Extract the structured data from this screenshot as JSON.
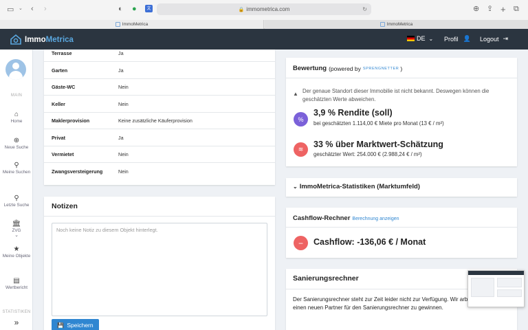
{
  "browser": {
    "url": "immometrica.com",
    "tabs": [
      "ImmoMetrica",
      "ImmoMetrica"
    ]
  },
  "header": {
    "logo_part1": "Immo",
    "logo_part2": "Metrica",
    "language": "DE",
    "profile": "Profil",
    "logout": "Logout"
  },
  "sidebar": {
    "section_main": "MAIN",
    "items": [
      {
        "label": "Home",
        "icon": "home-icon"
      },
      {
        "label": "Neue Suche",
        "icon": "search-plus-icon"
      },
      {
        "label": "Meine Suchen",
        "icon": "search-icon"
      },
      {
        "label": "Letzte Suche",
        "icon": "search-icon"
      },
      {
        "label": "ZVG",
        "icon": "bank-icon"
      },
      {
        "label": "Meine Objekte",
        "icon": "star-icon"
      },
      {
        "label": "Wertbericht",
        "icon": "report-icon"
      }
    ],
    "section_stats": "STATISTIKEN",
    "expand": "»"
  },
  "details": [
    {
      "key": "Terrasse",
      "value": "Ja"
    },
    {
      "key": "Garten",
      "value": "Ja"
    },
    {
      "key": "Gäste-WC",
      "value": "Nein"
    },
    {
      "key": "Keller",
      "value": "Nein"
    },
    {
      "key": "Maklerprovision",
      "value": "Keine zusätzliche Käuferprovision"
    },
    {
      "key": "Privat",
      "value": "Ja"
    },
    {
      "key": "Vermietet",
      "value": "Nein"
    },
    {
      "key": "Zwangsversteigerung",
      "value": "Nein"
    }
  ],
  "notes": {
    "title": "Notizen",
    "placeholder": "Noch keine Notiz zu diesem Objekt hinterlegt.",
    "save": "Speichern"
  },
  "valuation": {
    "title": "Bewertung",
    "powered_by": "(powered by",
    "brand": "SPRENGNETTER",
    "close_paren": ")",
    "warning": "Der genaue Standort dieser Immobilie ist nicht bekannt. Deswegen können die geschätzten Werte abweichen.",
    "yield_title": "3,9 % Rendite (soll)",
    "yield_sub": "bei geschätzten 1.114,00 € Miete pro Monat (13 € / m²)",
    "market_title": "33 % über Marktwert-Schätzung",
    "market_sub": "geschätzter Wert: 254.000 € (2.988,24 € / m²)",
    "color_purple": "#7b61d9",
    "color_red": "#ee6363"
  },
  "stats": {
    "title": "ImmoMetrica-Statistiken (Marktumfeld)"
  },
  "cashflow": {
    "title": "Cashflow-Rechner",
    "link": "Berechnung anzeigen",
    "value": "Cashflow: -136,06 € / Monat"
  },
  "renovation": {
    "title": "Sanierungsrechner",
    "text": "Der Sanierungsrechner steht zur Zeit leider nicht zur Verfügung. Wir arbeiten daran einen neuen Partner für den Sanierungsrechner zu gewinnen."
  }
}
